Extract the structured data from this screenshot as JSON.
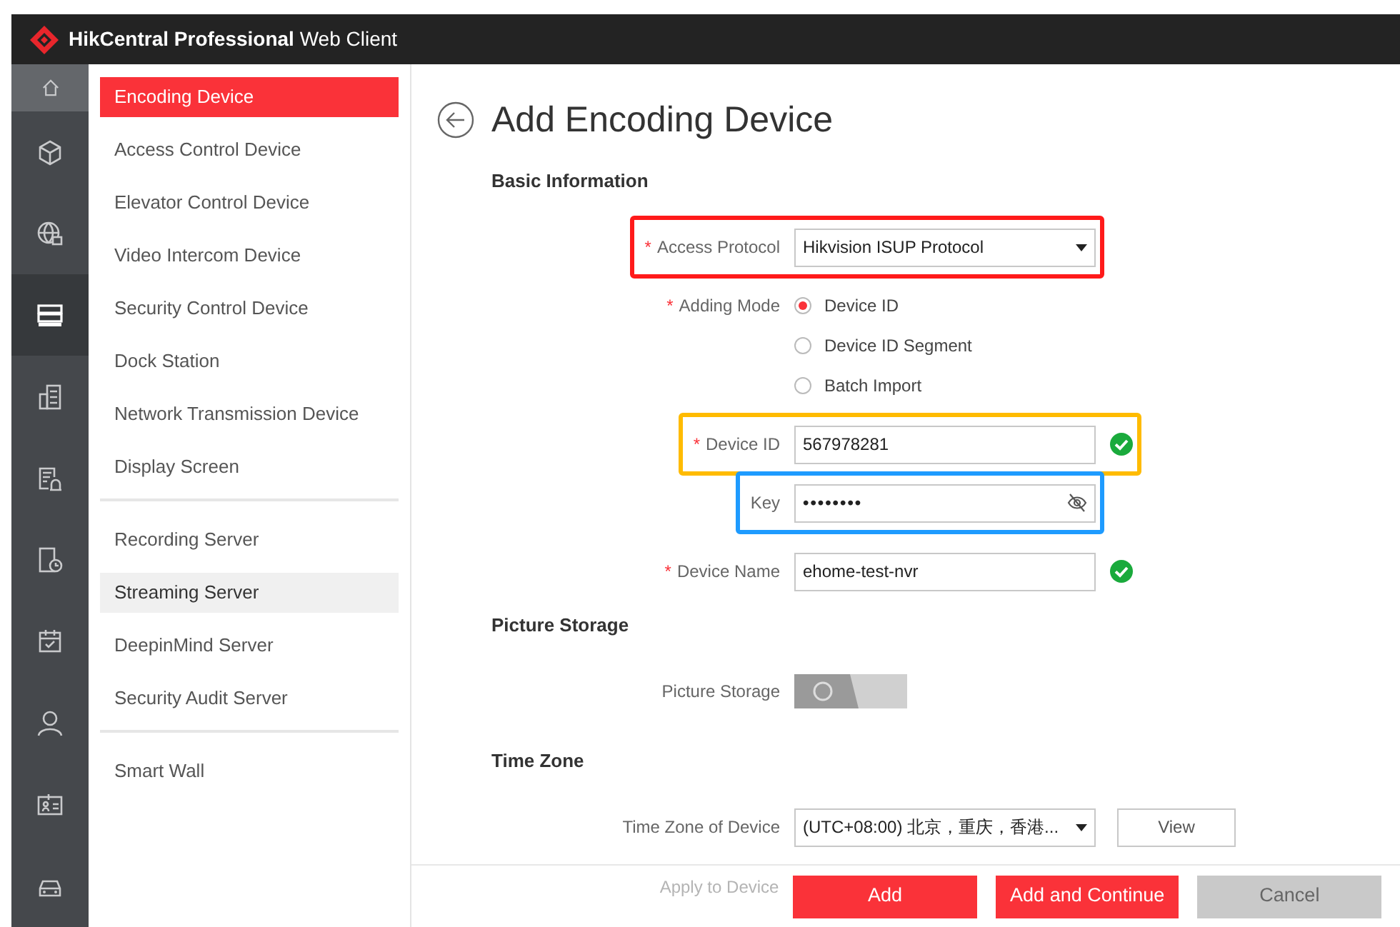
{
  "app": {
    "title_bold": "HikCentral Professional",
    "title": "Web Client"
  },
  "rail": [
    {
      "kind": "home",
      "selected": false,
      "hovered": true
    },
    {
      "kind": "cube",
      "selected": false,
      "hovered": false
    },
    {
      "kind": "globe",
      "selected": false,
      "hovered": false
    },
    {
      "kind": "server",
      "selected": true,
      "hovered": false
    },
    {
      "kind": "building",
      "selected": false,
      "hovered": false
    },
    {
      "kind": "report",
      "selected": false,
      "hovered": false
    },
    {
      "kind": "tablet",
      "selected": false,
      "hovered": false
    },
    {
      "kind": "calendar",
      "selected": false,
      "hovered": false
    },
    {
      "kind": "person",
      "selected": false,
      "hovered": false
    },
    {
      "kind": "card",
      "selected": false,
      "hovered": false
    },
    {
      "kind": "car",
      "selected": false,
      "hovered": false
    }
  ],
  "submenu": [
    [
      {
        "label": "Encoding Device",
        "selected": true,
        "hovered": false
      },
      {
        "label": "Access Control Device",
        "selected": false,
        "hovered": false
      },
      {
        "label": "Elevator Control Device",
        "selected": false,
        "hovered": false
      },
      {
        "label": "Video Intercom Device",
        "selected": false,
        "hovered": false
      },
      {
        "label": "Security Control Device",
        "selected": false,
        "hovered": false
      },
      {
        "label": "Dock Station",
        "selected": false,
        "hovered": false
      },
      {
        "label": "Network Transmission Device",
        "selected": false,
        "hovered": false
      },
      {
        "label": "Display Screen",
        "selected": false,
        "hovered": false
      }
    ],
    [
      {
        "label": "Recording Server",
        "selected": false,
        "hovered": false
      },
      {
        "label": "Streaming Server",
        "selected": false,
        "hovered": true
      },
      {
        "label": "DeepinMind Server",
        "selected": false,
        "hovered": false
      },
      {
        "label": "Security Audit Server",
        "selected": false,
        "hovered": false
      }
    ],
    [
      {
        "label": "Smart Wall",
        "selected": false,
        "hovered": false
      }
    ]
  ],
  "page_title": "Add Encoding Device",
  "sections": [
    {
      "title": "Basic Information",
      "fields": [
        {
          "kind": "select",
          "label": "Access Protocol",
          "required_mark": "*",
          "value": "Hikvision ISUP Protocol",
          "color": "#ff1a1a"
        },
        {
          "kind": "radio",
          "label": "Adding Mode",
          "required_mark": "*",
          "options": [
            {
              "label": "Device ID",
              "selected": true
            },
            {
              "label": "Device ID Segment",
              "selected": false
            },
            {
              "label": "Batch Import",
              "selected": false
            }
          ]
        },
        {
          "kind": "text",
          "label": "Device ID",
          "required_mark": "*",
          "value": "567978281",
          "valid": true,
          "color": "#ffbb00"
        },
        {
          "kind": "password",
          "label": "Key",
          "value": "••••••••",
          "color": "#1e9bff"
        },
        {
          "kind": "text",
          "label": "Device Name",
          "required_mark": "*",
          "value": "ehome-test-nvr",
          "valid": true
        }
      ]
    },
    {
      "title": "Picture Storage",
      "fields": [
        {
          "kind": "toggle",
          "label": "Picture Storage",
          "on": false
        }
      ]
    },
    {
      "title": "Time Zone",
      "fields": [
        {
          "kind": "select",
          "label": "Time Zone of Device",
          "value": "(UTC+08:00) 北京，重庆，香港...",
          "button": "View"
        }
      ]
    }
  ],
  "footer": {
    "behind_label": "Apply to Device",
    "buttons": [
      {
        "label": "Add",
        "kind": "primary"
      },
      {
        "label": "Add and Continue",
        "kind": "primary"
      },
      {
        "label": "Cancel",
        "kind": "secondary"
      }
    ]
  }
}
